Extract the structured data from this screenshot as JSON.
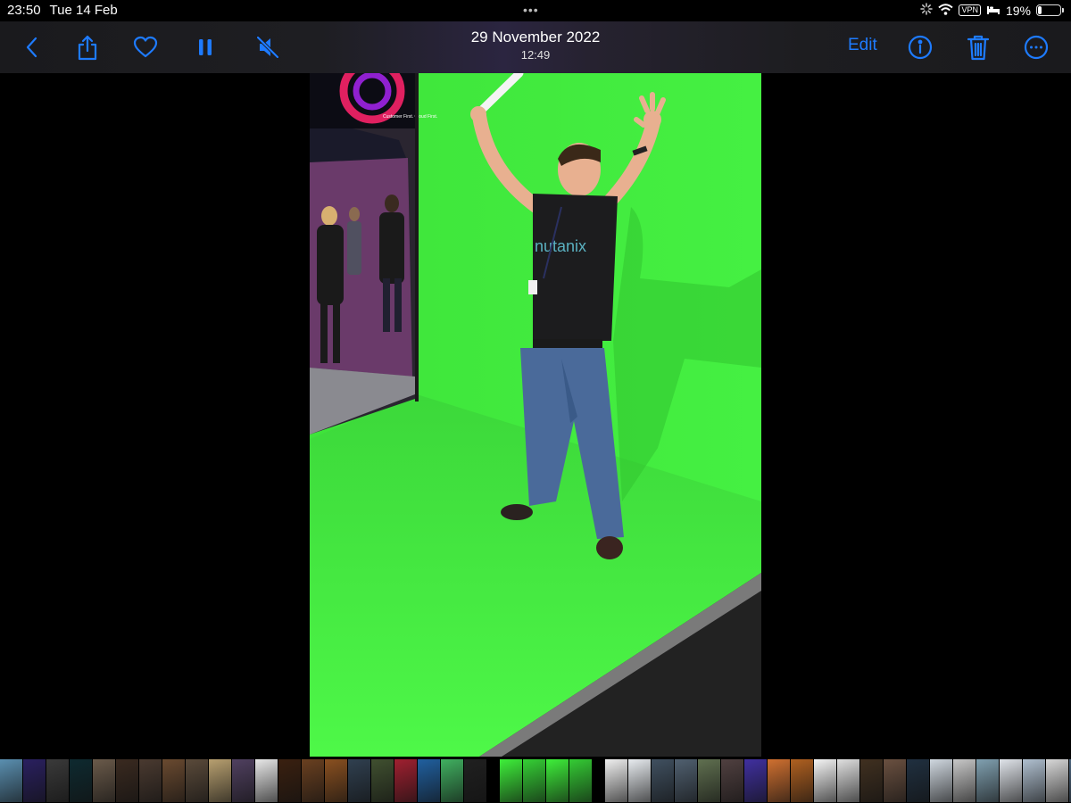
{
  "status": {
    "time": "23:50",
    "date": "Tue 14 Feb",
    "multitask_dots": "•••",
    "vpn_label": "VPN",
    "battery_percent": "19%",
    "battery_level": 0.19
  },
  "toolbar": {
    "title_date": "29 November 2022",
    "title_time": "12:49",
    "edit_label": "Edit",
    "icons": [
      "back-chevron-icon",
      "share-icon",
      "heart-icon",
      "pause-icon",
      "mute-icon",
      "info-icon",
      "trash-icon",
      "more-icon"
    ],
    "accent_color": "#1e7bff"
  },
  "photo": {
    "backdrop_color": "#3ef03a",
    "booth_screen_text": "Customer First. Cloud First.",
    "shirt_text": "nutanix"
  },
  "filmstrip": {
    "thumbnails": [
      {
        "color": "#5a8fb0"
      },
      {
        "color": "#2a2060"
      },
      {
        "color": "#3a3a3a"
      },
      {
        "color": "#0e2a30"
      },
      {
        "color": "#6a5a4a"
      },
      {
        "color": "#3a2a20"
      },
      {
        "color": "#4a3a30"
      },
      {
        "color": "#6a4a30"
      },
      {
        "color": "#5a4a3a"
      },
      {
        "color": "#b8a070"
      },
      {
        "color": "#504060"
      },
      {
        "color": "#e8e8e8"
      },
      {
        "color": "#3a2010"
      },
      {
        "color": "#6a4020"
      },
      {
        "color": "#8a5020"
      },
      {
        "color": "#304050"
      },
      {
        "color": "#405030"
      },
      {
        "color": "#a02030"
      },
      {
        "color": "#2060a0"
      },
      {
        "color": "#40b060"
      },
      {
        "color": "#202020"
      },
      {
        "color": "gap"
      },
      {
        "color": "#3ef03a"
      },
      {
        "color": "#35d035"
      },
      {
        "color": "#3ef03a"
      },
      {
        "color": "#34cc34"
      },
      {
        "color": "gap"
      },
      {
        "color": "#f0f0f0"
      },
      {
        "color": "#e8ecf0"
      },
      {
        "color": "#405060"
      },
      {
        "color": "#506070"
      },
      {
        "color": "#607050"
      },
      {
        "color": "#504040"
      },
      {
        "color": "#4030a0"
      },
      {
        "color": "#d07030"
      },
      {
        "color": "#b06020"
      },
      {
        "color": "#f5f5f5"
      },
      {
        "color": "#e0e0e0"
      },
      {
        "color": "#403020"
      },
      {
        "color": "#6a5040"
      },
      {
        "color": "#203040"
      },
      {
        "color": "#d0d8e0"
      },
      {
        "color": "#c8c8c8"
      },
      {
        "color": "#80a0b0"
      },
      {
        "color": "#e0e4ea"
      },
      {
        "color": "#b0c0d0"
      },
      {
        "color": "#d8d8d8"
      },
      {
        "color": "#506880"
      }
    ]
  }
}
